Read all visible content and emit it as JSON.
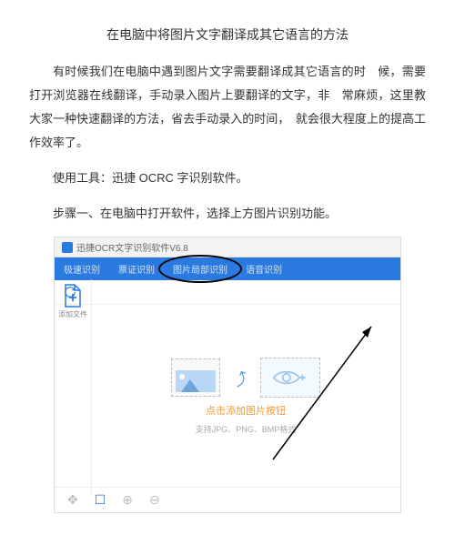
{
  "title": "在电脑中将图片文字翻译成其它语言的方法",
  "p1": "有时候我们在电脑中遇到图片文字需要翻译成其它语言的时　候，需要打开浏览器在线翻译，手动录入图片上要翻译的文字，非　常麻烦，这里教大家一种快速翻译的方法，省去手动录入的时间，　就会很大程度上的提高工作效率了。",
  "p2": "使用工具：迅捷 OCRC 字识别软件。",
  "p3": "步骤一、在电脑中打开软件，选择上方图片识别功能。",
  "app": {
    "window_title": "迅捷OCR文字识别软件V6.8",
    "nav": [
      "极速识别",
      "票证识别",
      "图片局部识别",
      "语音识别"
    ],
    "sidebar": {
      "addfile": "添加文件"
    },
    "main": {
      "upload_label": "点击添加图片按钮",
      "formats": "支持JPG、PNG、BMP格式"
    }
  }
}
